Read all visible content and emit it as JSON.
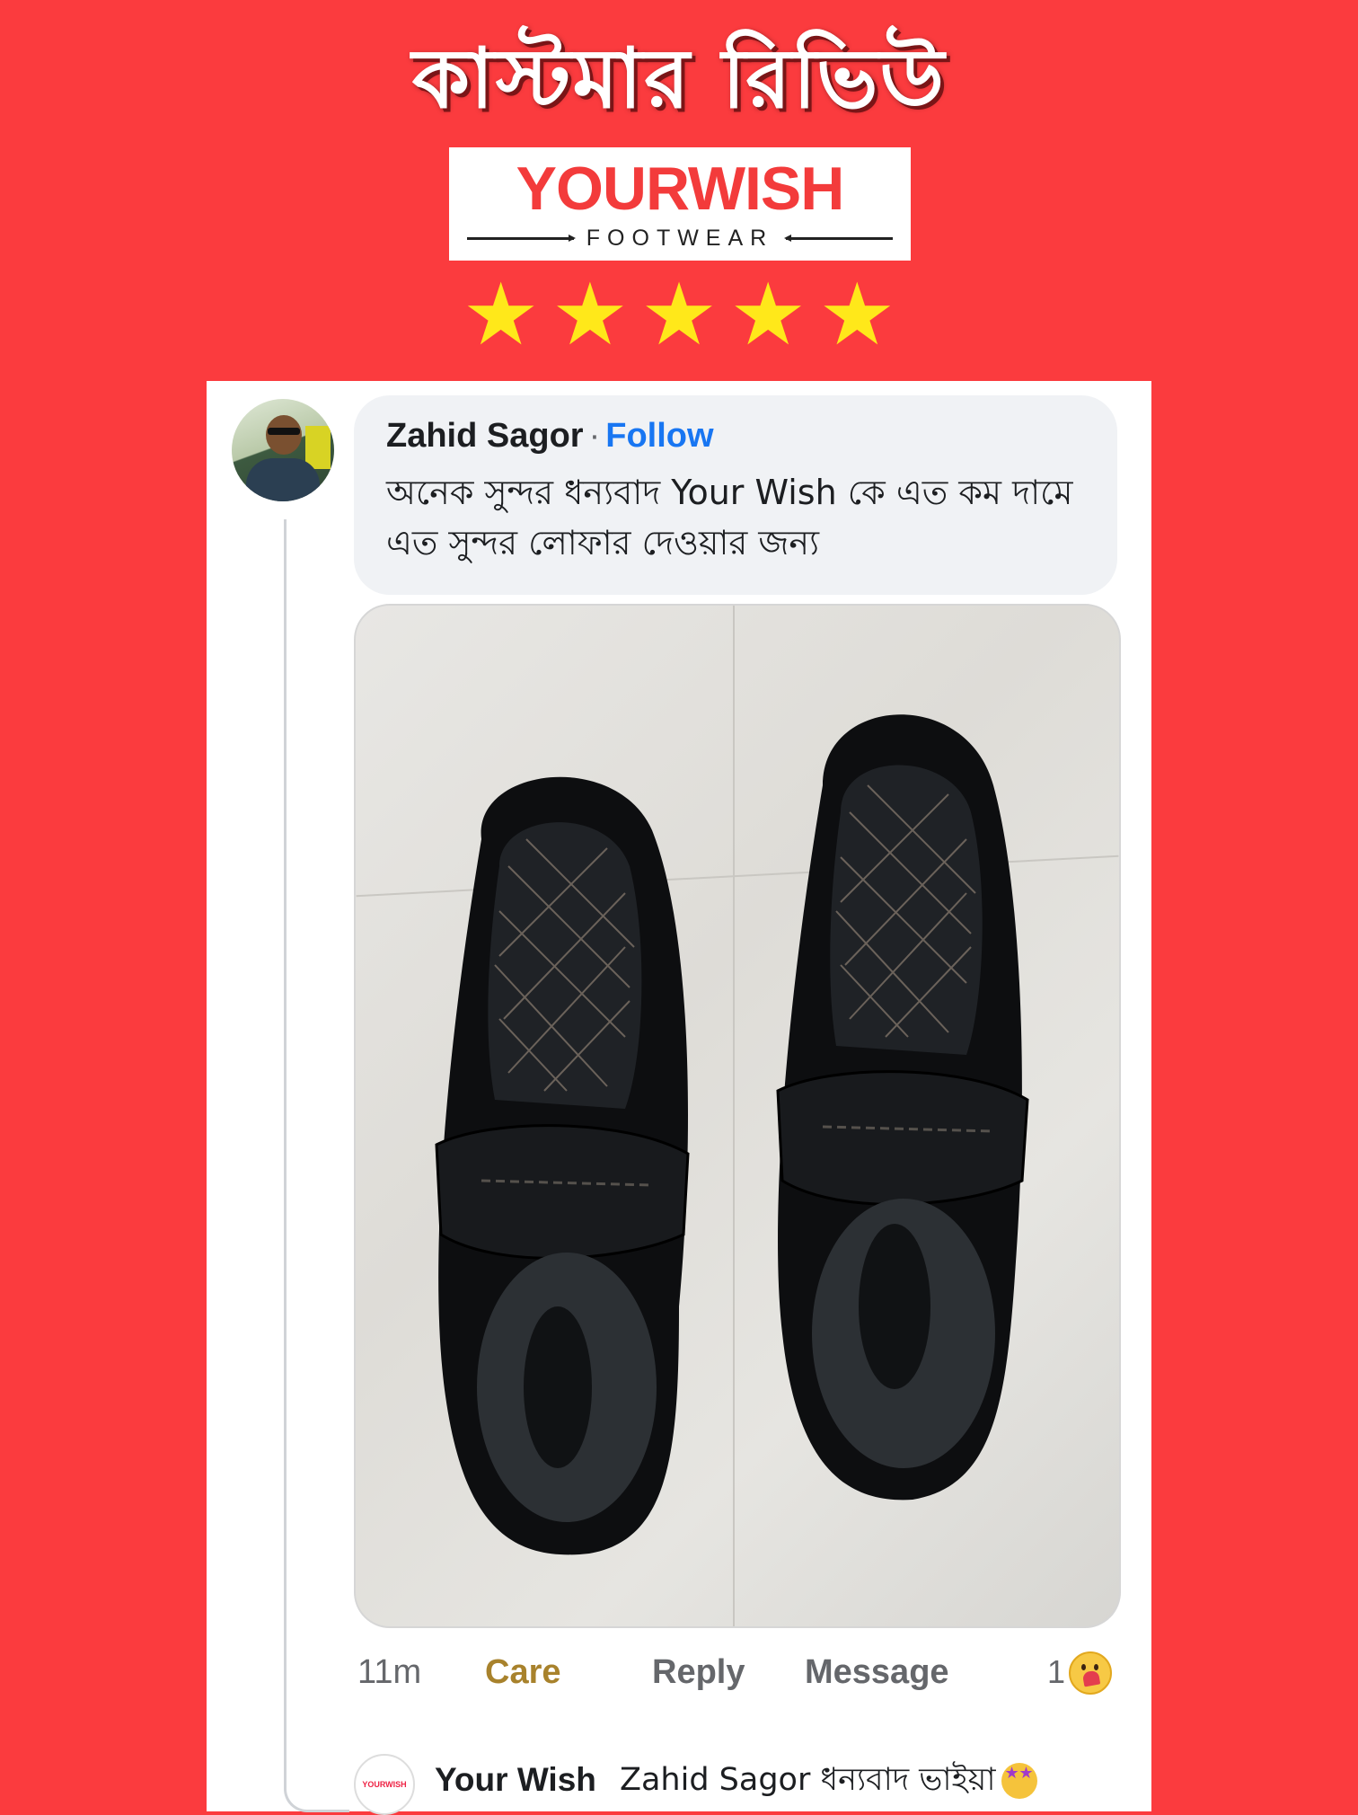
{
  "banner": {
    "title": "কাস্টমার রিভিউ",
    "logo_word": "YOURWISH",
    "logo_sub": "FOOTWEAR",
    "star_color": "#ffe81a",
    "background": "#fb3b3e"
  },
  "comment": {
    "author": "Zahid Sagor",
    "separator": "·",
    "follow_label": "Follow",
    "text": "অনেক সুন্দর ধন্যবাদ Your Wish কে  এত কম দামে এত সুন্দর লোফার দেওয়ার জন্য"
  },
  "actions": {
    "time": "11m",
    "care": "Care",
    "reply": "Reply",
    "message": "Message",
    "reaction_count": "1"
  },
  "reply": {
    "avatar_text": "YOURWISH",
    "author": "Your Wish",
    "text": "Zahid Sagor ধন্যবাদ ভাইয়া"
  },
  "rating": 5
}
